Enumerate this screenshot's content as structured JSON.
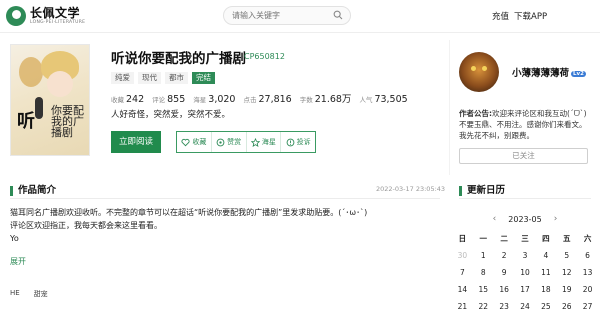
{
  "site": {
    "logo_title": "长佩文学",
    "logo_sub": "LONG·PEI·LITERATURE"
  },
  "search": {
    "placeholder": "请输入关键字"
  },
  "topnav": {
    "recharge": "充值",
    "download": "下载APP"
  },
  "cover": {
    "title_big": "听",
    "title_small": "你要配我的广播剧"
  },
  "book": {
    "title": "听说你要配我的广播剧",
    "id": "CP650812",
    "tags": [
      "纯爱",
      "现代",
      "都市",
      "完结"
    ],
    "stats": [
      {
        "label": "收藏",
        "value": "242"
      },
      {
        "label": "评论",
        "value": "855"
      },
      {
        "label": "海星",
        "value": "3,020"
      },
      {
        "label": "点击",
        "value": "27,816"
      },
      {
        "label": "字数",
        "value": "21.68万"
      },
      {
        "label": "人气",
        "value": "73,505"
      }
    ],
    "tagline": "人好奇怪，突然爱，突然不爱。",
    "read_button": "立即阅读",
    "actions": [
      "收藏",
      "赞赏",
      "海星",
      "投诉"
    ]
  },
  "intro": {
    "title": "作品简介",
    "date": "2022-03-17 23:05:43",
    "lines": [
      "猫耳同名广播剧欢迎收听。不完整的章节可以在超话“听说你要配我的广播剧”里发求助贴要。(´･ω･`)",
      "评论区欢迎指正，我每天都会来这里看看。",
      "Yo"
    ],
    "more": "展开",
    "tags": [
      "HE",
      "甜宠"
    ]
  },
  "author": {
    "name": "小薄薄薄薄荷",
    "level": "Lv2",
    "note_label": "作者公告:",
    "note": "欢迎来评论区和我互动(ˊᗜˋ)不要玉鼎、不用注。感谢你们来看文。我先花不纠，别跟费。",
    "follow_button": "已关注"
  },
  "calendar": {
    "title": "更新日历",
    "month": "2023-05",
    "prev": "‹",
    "next": "›",
    "weekdays": [
      "日",
      "一",
      "二",
      "三",
      "四",
      "五",
      "六"
    ],
    "days": [
      "30",
      "1",
      "2",
      "3",
      "4",
      "5",
      "6",
      "7",
      "8",
      "9",
      "10",
      "11",
      "12",
      "13",
      "14",
      "15",
      "16",
      "17",
      "18",
      "19",
      "20",
      "21",
      "22",
      "23",
      "24",
      "25",
      "26",
      "27"
    ]
  },
  "colors": {
    "accent": "#2e8b57",
    "button": "#218b4d"
  }
}
